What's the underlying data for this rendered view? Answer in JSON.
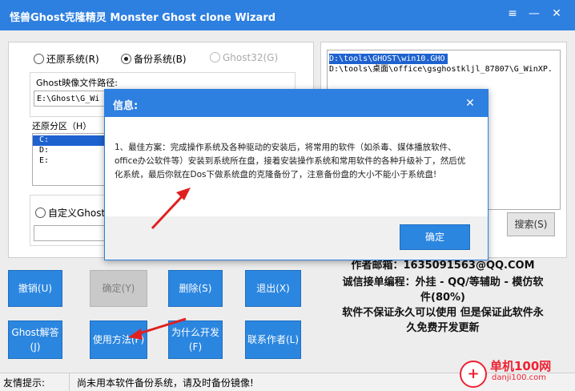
{
  "window": {
    "title": "怪兽Ghost克隆精灵 Monster Ghost clone Wizard",
    "controls": [
      "≡",
      "—",
      "✕"
    ]
  },
  "mode": {
    "restore_label": "还原系统(R)",
    "backup_label": "备份系统(B)",
    "ghost32_label": "Ghost32(G)",
    "selected": "backup"
  },
  "image_path": {
    "label": "Ghost映像文件路径:",
    "value": "E:\\Ghost\\G_Wi"
  },
  "partition": {
    "label": "还原分区（H）",
    "rows": [
      "C:",
      "D:",
      "E:"
    ],
    "col2": [
      ":",
      ":",
      ":"
    ]
  },
  "custom_ghost": {
    "label": "自定义Ghost"
  },
  "file_list": {
    "items": [
      "D:\\tools\\GHOST\\win10.GHO",
      "D:\\tools\\桌面\\office\\gsghostkljl_87807\\G_WinXP."
    ],
    "selected_index": 0
  },
  "search_button": "搜索(S)",
  "buttons": {
    "cancel": "撤销(U)",
    "confirm": "确定(Y)",
    "delete": "删除(S)",
    "exit": "退出(X)",
    "ghost_explain_line1": "Ghost解答",
    "ghost_explain_line2": "(J)",
    "usage": "使用方法(F)",
    "why_line1": "为什么开发",
    "why_line2": "(F)",
    "contact": "联系作者(L)"
  },
  "author_info": {
    "line1": "作者邮箱：1635091563@QQ.COM",
    "line2": "诚信接单编程：外挂 - QQ/等辅助 - 模仿软",
    "line3": "件(80%)",
    "line4": "软件不保证永久可以使用 但是保证此软件永",
    "line5": "久免费开发更新"
  },
  "status_bar": {
    "label": "友情提示:",
    "message": "尚未用本软件备份系统，请及时备份镜像!"
  },
  "dialog": {
    "title": "信息:",
    "body": "1、最佳方案：完成操作系统及各种驱动的安装后，将常用的软件（如杀毒、媒体播放软件、office办公软件等）安装到系统所在盘，接着安装操作系统和常用软件的各种升级补丁，然后优化系统，最后你就在Dos下做系统盘的克隆备份了，注意备份盘的大小不能小于系统盘!",
    "ok_label": "确定"
  },
  "watermark": {
    "text1": "单机100网",
    "text2": "danji100.com"
  },
  "colors": {
    "accent": "#2d7fe0",
    "button": "#2b86e0",
    "arrow": "#e02020"
  }
}
